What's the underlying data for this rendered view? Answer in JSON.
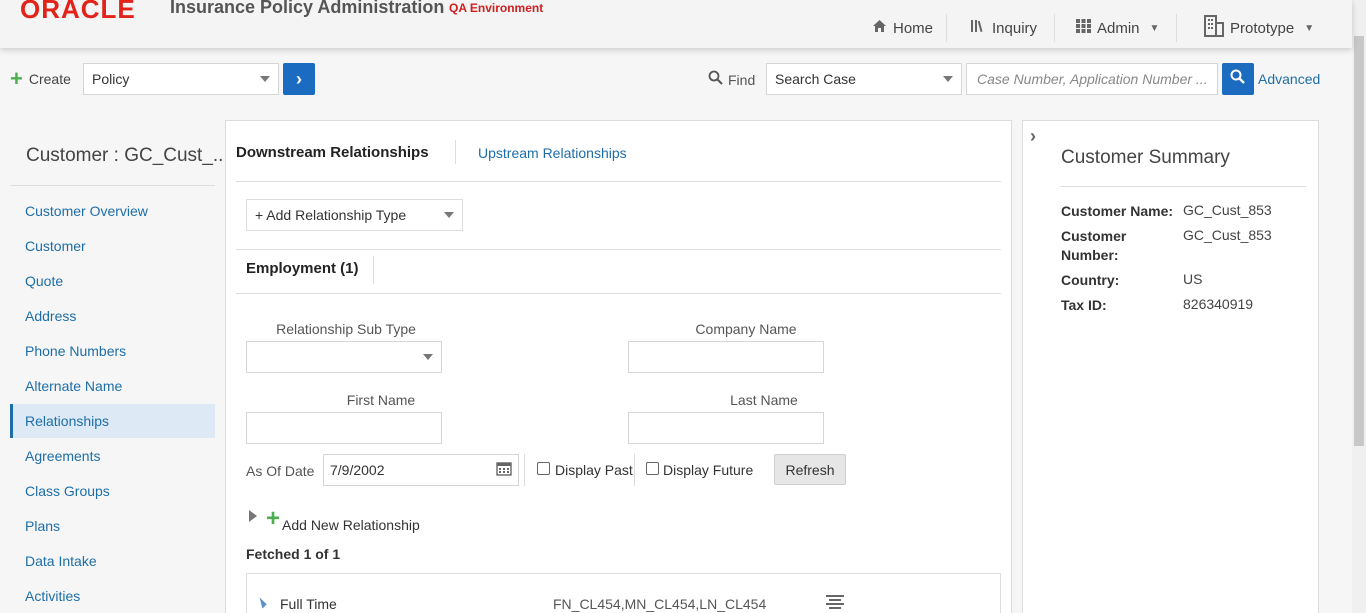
{
  "header": {
    "logo": "ORACLE",
    "title": "Insurance Policy Administration",
    "environment": "QA Environment",
    "nav": [
      {
        "label": "Home",
        "icon": "home-icon"
      },
      {
        "label": "Inquiry",
        "icon": "library-icon"
      },
      {
        "label": "Admin",
        "icon": "grid-icon"
      },
      {
        "label": "Prototype",
        "icon": "building-icon"
      }
    ]
  },
  "toolbar": {
    "create_label": "Create",
    "create_select": "Policy",
    "find_label": "Find",
    "find_select": "Search Case",
    "search_placeholder": "Case Number,  Application Number ...",
    "advanced_label": "Advanced"
  },
  "sidebar": {
    "title": "Customer : GC_Cust_...",
    "items": [
      {
        "label": "Customer Overview"
      },
      {
        "label": "Customer"
      },
      {
        "label": "Quote"
      },
      {
        "label": "Address"
      },
      {
        "label": "Phone Numbers"
      },
      {
        "label": "Alternate Name"
      },
      {
        "label": "Relationships",
        "active": true
      },
      {
        "label": "Agreements"
      },
      {
        "label": "Class Groups"
      },
      {
        "label": "Plans"
      },
      {
        "label": "Data Intake"
      },
      {
        "label": "Activities"
      }
    ]
  },
  "main": {
    "tab_active": "Downstream Relationships",
    "tab_other": "Upstream Relationships",
    "add_relationship_type": "+ Add Relationship Type",
    "section_title": "Employment (1)",
    "labels": {
      "relationship_sub_type": "Relationship Sub Type",
      "company_name": "Company Name",
      "first_name": "First Name",
      "last_name": "Last Name",
      "as_of_date": "As Of Date",
      "display_past": "Display Past",
      "display_future": "Display Future",
      "refresh": "Refresh",
      "add_new_relationship": "Add New Relationship",
      "fetched": "Fetched 1 of 1"
    },
    "as_of_date_value": "7/9/2002",
    "row": {
      "type": "Full Time",
      "names": "FN_CL454,MN_CL454,LN_CL454"
    }
  },
  "summary": {
    "title": "Customer Summary",
    "fields": [
      {
        "label": "Customer Name:",
        "value": "GC_Cust_853"
      },
      {
        "label": "Customer Number:",
        "value": "GC_Cust_853"
      },
      {
        "label": "Country:",
        "value": "US"
      },
      {
        "label": "Tax ID:",
        "value": "826340919"
      }
    ]
  },
  "colors": {
    "accent": "#1b6cc0",
    "link": "#1d6ea8",
    "brand_red": "#e2231a",
    "add_green": "#4caf50"
  }
}
